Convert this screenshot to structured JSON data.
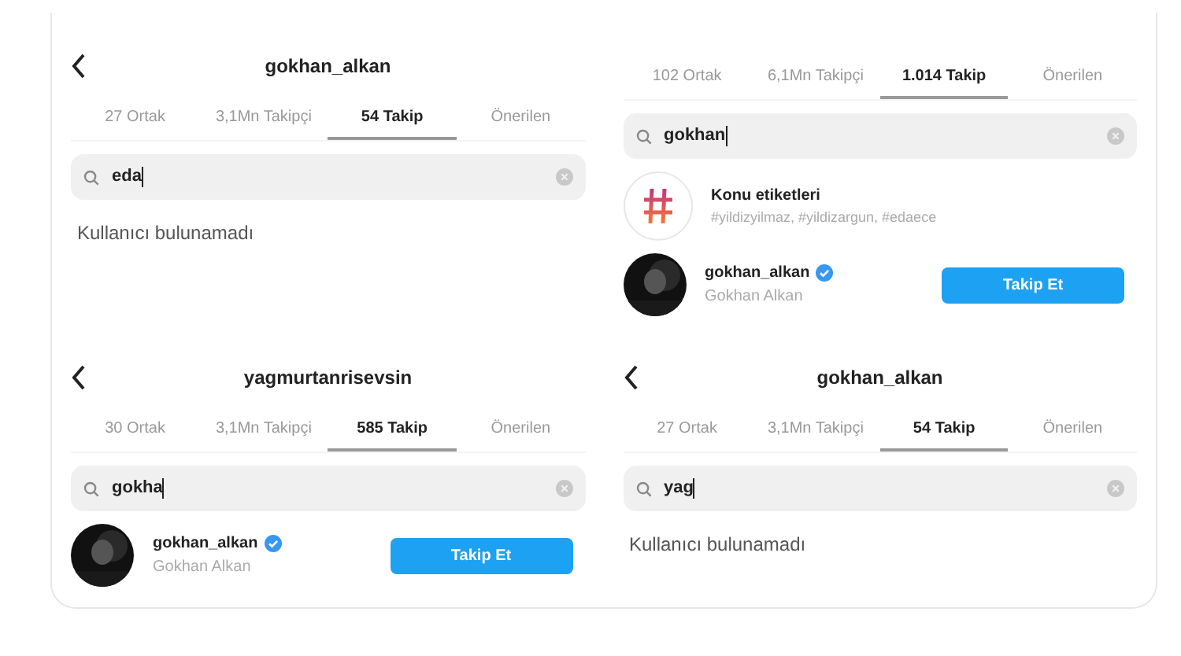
{
  "panels": [
    {
      "title": "gokhan_alkan",
      "tabs": [
        {
          "label": "27 Ortak",
          "selected": false
        },
        {
          "label": "3,1Mn Takipçi",
          "selected": false
        },
        {
          "label": "54 Takip",
          "selected": true
        },
        {
          "label": "Önerilen",
          "selected": false
        }
      ],
      "search": {
        "value": "eda"
      },
      "results": [
        {
          "kind": "empty",
          "text": "Kullanıcı bulunamadı"
        }
      ]
    },
    {
      "tabs": [
        {
          "label": "102 Ortak",
          "selected": false
        },
        {
          "label": "6,1Mn Takipçi",
          "selected": false
        },
        {
          "label": "1.014 Takip",
          "selected": true
        },
        {
          "label": "Önerilen",
          "selected": false
        }
      ],
      "search": {
        "value": "gokhan"
      },
      "results": [
        {
          "kind": "hashtag",
          "title": "Konu etiketleri",
          "subtitle": "#yildizyilmaz, #yildizargun, #edaece"
        },
        {
          "kind": "user",
          "username": "gokhan_alkan",
          "verified": true,
          "name": "Gokhan Alkan",
          "button": "Takip Et"
        }
      ]
    },
    {
      "title": "yagmurtanrisevsin",
      "tabs": [
        {
          "label": "30 Ortak",
          "selected": false
        },
        {
          "label": "3,1Mn Takipçi",
          "selected": false
        },
        {
          "label": "585 Takip",
          "selected": true
        },
        {
          "label": "Önerilen",
          "selected": false
        }
      ],
      "search": {
        "value": "gokha"
      },
      "results": [
        {
          "kind": "user",
          "username": "gokhan_alkan",
          "verified": true,
          "name": "Gokhan Alkan",
          "button": "Takip Et"
        }
      ]
    },
    {
      "title": "gokhan_alkan",
      "tabs": [
        {
          "label": "27 Ortak",
          "selected": false
        },
        {
          "label": "3,1Mn Takipçi",
          "selected": false
        },
        {
          "label": "54 Takip",
          "selected": true
        },
        {
          "label": "Önerilen",
          "selected": false
        }
      ],
      "search": {
        "value": "yag"
      },
      "results": [
        {
          "kind": "empty",
          "text": "Kullanıcı bulunamadı"
        }
      ]
    }
  ]
}
